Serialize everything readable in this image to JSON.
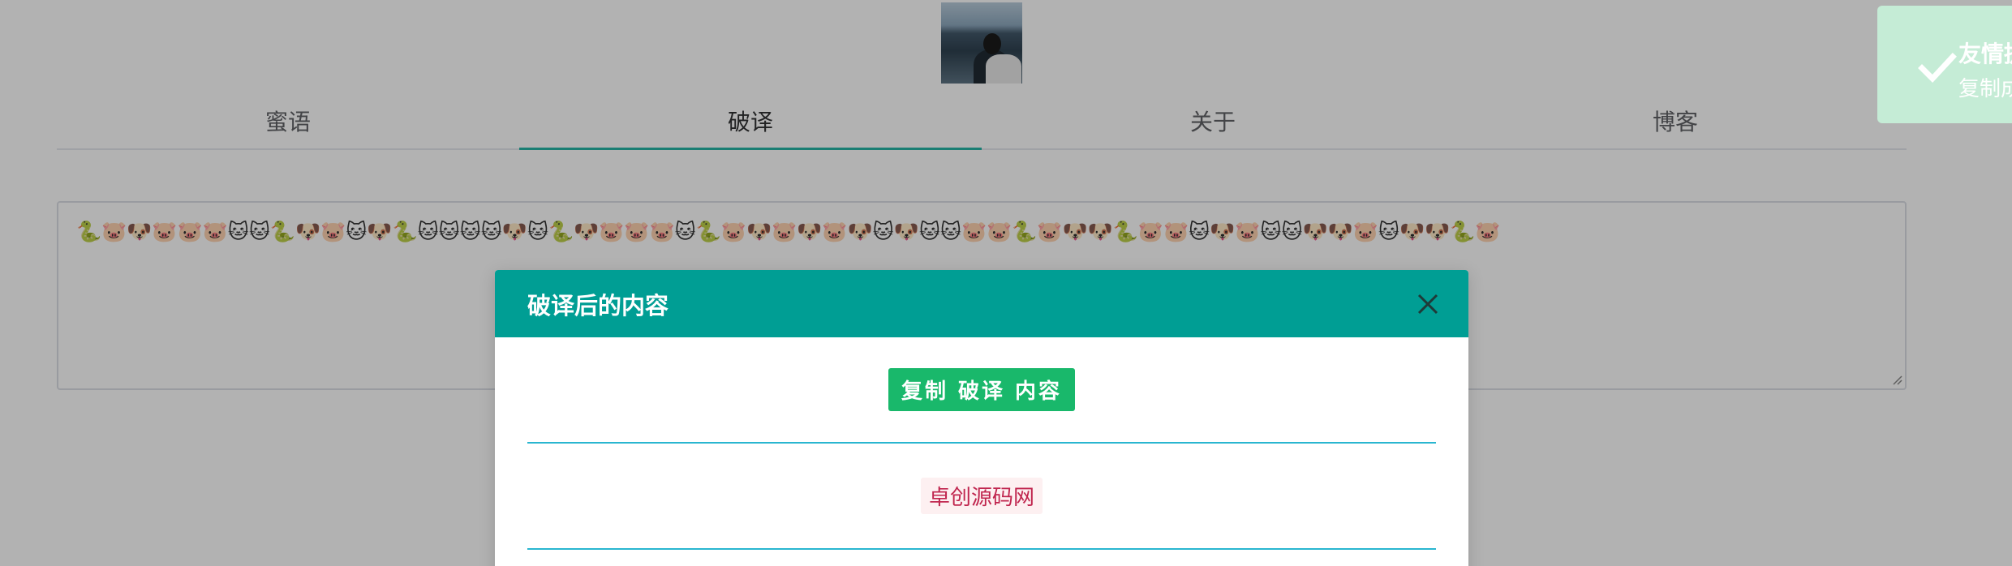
{
  "tabs": [
    {
      "label": "蜜语"
    },
    {
      "label": "破译"
    },
    {
      "label": "关于"
    },
    {
      "label": "博客"
    }
  ],
  "active_tab": 1,
  "editor": {
    "value": "🐍🐷🐶🐷🐷🐷🐱🐱🐍🐶🐷🐱🐶🐍🐱🐱🐱🐱🐶🐱🐍🐶🐷🐷🐷🐱🐍🐷🐶🐷🐶🐷🐶🐱🐶🐱🐱🐷🐷🐍🐷🐶🐶🐍🐷🐷🐱🐶🐷🐱🐱🐶🐶🐷🐱🐶🐶🐍🐷"
  },
  "toast": {
    "title": "友情提",
    "message": "复制成",
    "icon": "check-icon",
    "color": "#c5ecd6"
  },
  "dialog": {
    "title": "破译后的内容",
    "copy_button": "复制 破译 内容",
    "result": "卓创源码网",
    "header_color": "#009e94",
    "button_color": "#19b86b"
  }
}
